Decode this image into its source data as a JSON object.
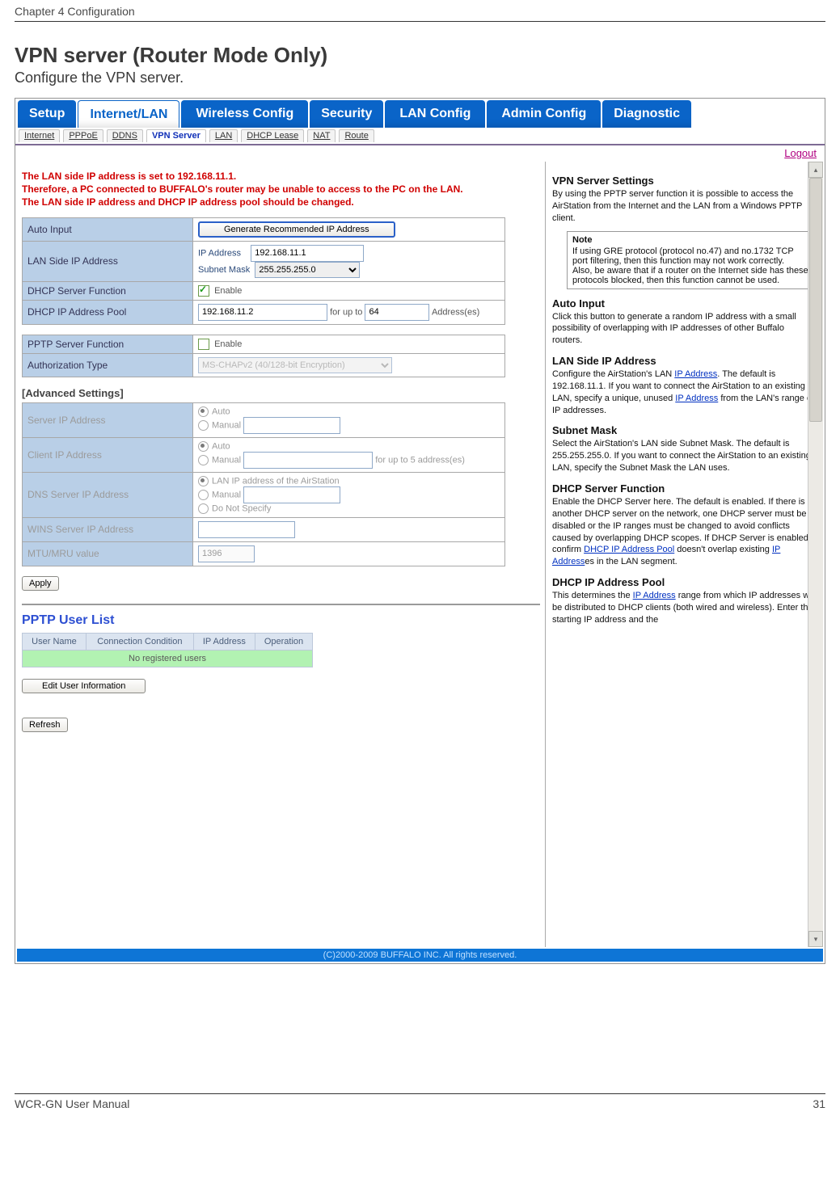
{
  "doc": {
    "chapter": "Chapter 4  Configuration",
    "section_title": "VPN server (Router Mode Only)",
    "section_sub": "Configure the VPN server.",
    "footer_left": "WCR-GN User Manual",
    "footer_right": "31"
  },
  "tabs": {
    "items": [
      {
        "label": "Setup"
      },
      {
        "label": "Internet/LAN",
        "active": true
      },
      {
        "label": "Wireless Config"
      },
      {
        "label": "Security"
      },
      {
        "label": "LAN Config"
      },
      {
        "label": "Admin Config"
      },
      {
        "label": "Diagnostic"
      }
    ]
  },
  "subtabs": {
    "items": [
      {
        "label": "Internet"
      },
      {
        "label": "PPPoE"
      },
      {
        "label": "DDNS"
      },
      {
        "label": "VPN Server",
        "active": true
      },
      {
        "label": "LAN"
      },
      {
        "label": "DHCP Lease"
      },
      {
        "label": "NAT"
      },
      {
        "label": "Route"
      }
    ]
  },
  "logout": "Logout",
  "warning": "The LAN side IP address is set to 192.168.11.1.\nTherefore, a PC connected to BUFFALO's router may be unable to access to the PC on the LAN.\nThe LAN side IP address and DHCP IP address pool should be changed.",
  "form": {
    "auto_input_label": "Auto Input",
    "generate_btn": "Generate Recommended IP Address",
    "lan_ip_label": "LAN Side IP Address",
    "ip_address_label": "IP Address",
    "ip_address_value": "192.168.11.1",
    "subnet_mask_label": "Subnet Mask",
    "subnet_mask_value": "255.255.255.0",
    "dhcp_server_label": "DHCP Server Function",
    "enable_label": "Enable",
    "dhcp_pool_label": "DHCP IP Address Pool",
    "dhcp_pool_start": "192.168.11.2",
    "for_up_to": "for up to",
    "dhcp_pool_count": "64",
    "addresses": "Address(es)",
    "pptp_server_label": "PPTP Server Function",
    "auth_type_label": "Authorization Type",
    "auth_type_value": "MS-CHAPv2 (40/128-bit Encryption)"
  },
  "advanced": {
    "title": "[Advanced Settings]",
    "server_ip_label": "Server IP Address",
    "auto": "Auto",
    "manual": "Manual",
    "client_ip_label": "Client IP Address",
    "client_suffix": "for up to 5 address(es)",
    "dns_label": "DNS Server IP Address",
    "dns_opt1": "LAN IP address of the AirStation",
    "dns_opt2": "Manual",
    "dns_opt3": "Do Not Specify",
    "wins_label": "WINS Server IP Address",
    "mtu_label": "MTU/MRU value",
    "mtu_value": "1396"
  },
  "buttons": {
    "apply": "Apply",
    "edit_user": "Edit User Information",
    "refresh": "Refresh"
  },
  "pptp_list": {
    "title": "PPTP User List",
    "columns": [
      "User Name",
      "Connection Condition",
      "IP Address",
      "Operation"
    ],
    "empty": "No registered users"
  },
  "help": {
    "title1": "VPN Server Settings",
    "para1": "By using the PPTP server function it is possible to access the AirStation from the Internet and the LAN from a Windows PPTP client.",
    "note_label": "Note",
    "note_body": "If using GRE protocol (protocol no.47) and no.1732 TCP port filtering, then this function may not work correctly.\nAlso, be aware that if a router on the Internet side has these protocols blocked, then this function cannot be used.",
    "title_auto": "Auto Input",
    "para_auto": "Click this button to generate a random IP address with a small possibility of overlapping with IP addresses of other Buffalo routers.",
    "title_lanip": "LAN Side IP Address",
    "para_lanip_a": "Configure the AirStation's LAN ",
    "para_lanip_link1": "IP Address",
    "para_lanip_b": ". The default is 192.168.11.1. If you want to connect the AirStation to an existing LAN, specify a unique, unused ",
    "para_lanip_link2": "IP Address",
    "para_lanip_c": " from the LAN's range of IP addresses.",
    "title_subnet": "Subnet Mask",
    "para_subnet": "Select the AirStation's LAN side Subnet Mask. The default is 255.255.255.0. If you want to connect the AirStation to an existing LAN, specify the Subnet Mask the LAN uses.",
    "title_dhcp": "DHCP Server Function",
    "para_dhcp_a": "Enable the DHCP Server here. The default is enabled. If there is another DHCP server on the network, one DHCP server must be disabled or the IP ranges must be changed to avoid conflicts caused by overlapping DHCP scopes. If DHCP Server is enabled, confirm ",
    "para_dhcp_link1": "DHCP IP Address Pool",
    "para_dhcp_b": " doesn't overlap existing ",
    "para_dhcp_link2": "IP Address",
    "para_dhcp_c": "es in the LAN segment.",
    "title_pool": "DHCP IP Address Pool",
    "para_pool_a": "This determines the ",
    "para_pool_link": "IP Address",
    "para_pool_b": " range from which IP addresses will be distributed to DHCP clients (both wired and wireless). Enter the starting IP address and the"
  },
  "footer_copyright": "(C)2000-2009 BUFFALO INC. All rights reserved."
}
